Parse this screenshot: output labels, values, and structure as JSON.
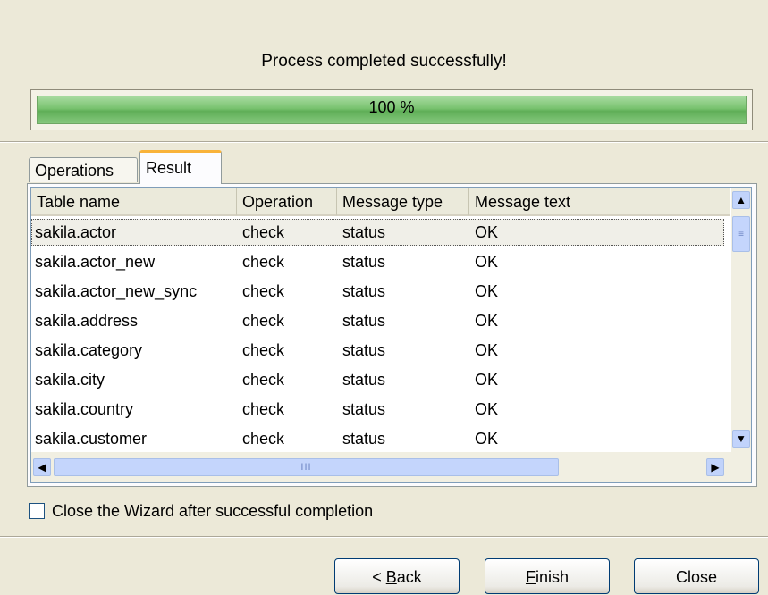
{
  "status_message": "Process completed successfully!",
  "progress": {
    "percent": 100,
    "label": "100 %"
  },
  "tabs": [
    {
      "label": "Operations",
      "active": false
    },
    {
      "label": "Result",
      "active": true
    }
  ],
  "grid": {
    "columns": [
      "Table name",
      "Operation",
      "Message type",
      "Message text"
    ],
    "rows": [
      {
        "table": "sakila.actor",
        "operation": "check",
        "type": "status",
        "text": "OK"
      },
      {
        "table": "sakila.actor_new",
        "operation": "check",
        "type": "status",
        "text": "OK"
      },
      {
        "table": "sakila.actor_new_sync",
        "operation": "check",
        "type": "status",
        "text": "OK"
      },
      {
        "table": "sakila.address",
        "operation": "check",
        "type": "status",
        "text": "OK"
      },
      {
        "table": "sakila.category",
        "operation": "check",
        "type": "status",
        "text": "OK"
      },
      {
        "table": "sakila.city",
        "operation": "check",
        "type": "status",
        "text": "OK"
      },
      {
        "table": "sakila.country",
        "operation": "check",
        "type": "status",
        "text": "OK"
      },
      {
        "table": "sakila.customer",
        "operation": "check",
        "type": "status",
        "text": "OK"
      }
    ],
    "selected_row": 0
  },
  "options": {
    "close_wizard_label": "Close the Wizard after successful completion",
    "close_wizard_checked": false
  },
  "buttons": {
    "back_rest": "ack",
    "back_mnemonic": "B",
    "finish_rest": "inish",
    "finish_mnemonic": "F",
    "close": "Close"
  },
  "scrollbar_glyphs": {
    "up": "▲",
    "down": "▼",
    "left": "◀",
    "right": "▶",
    "vgrip": "≡",
    "hgrip": "III"
  }
}
